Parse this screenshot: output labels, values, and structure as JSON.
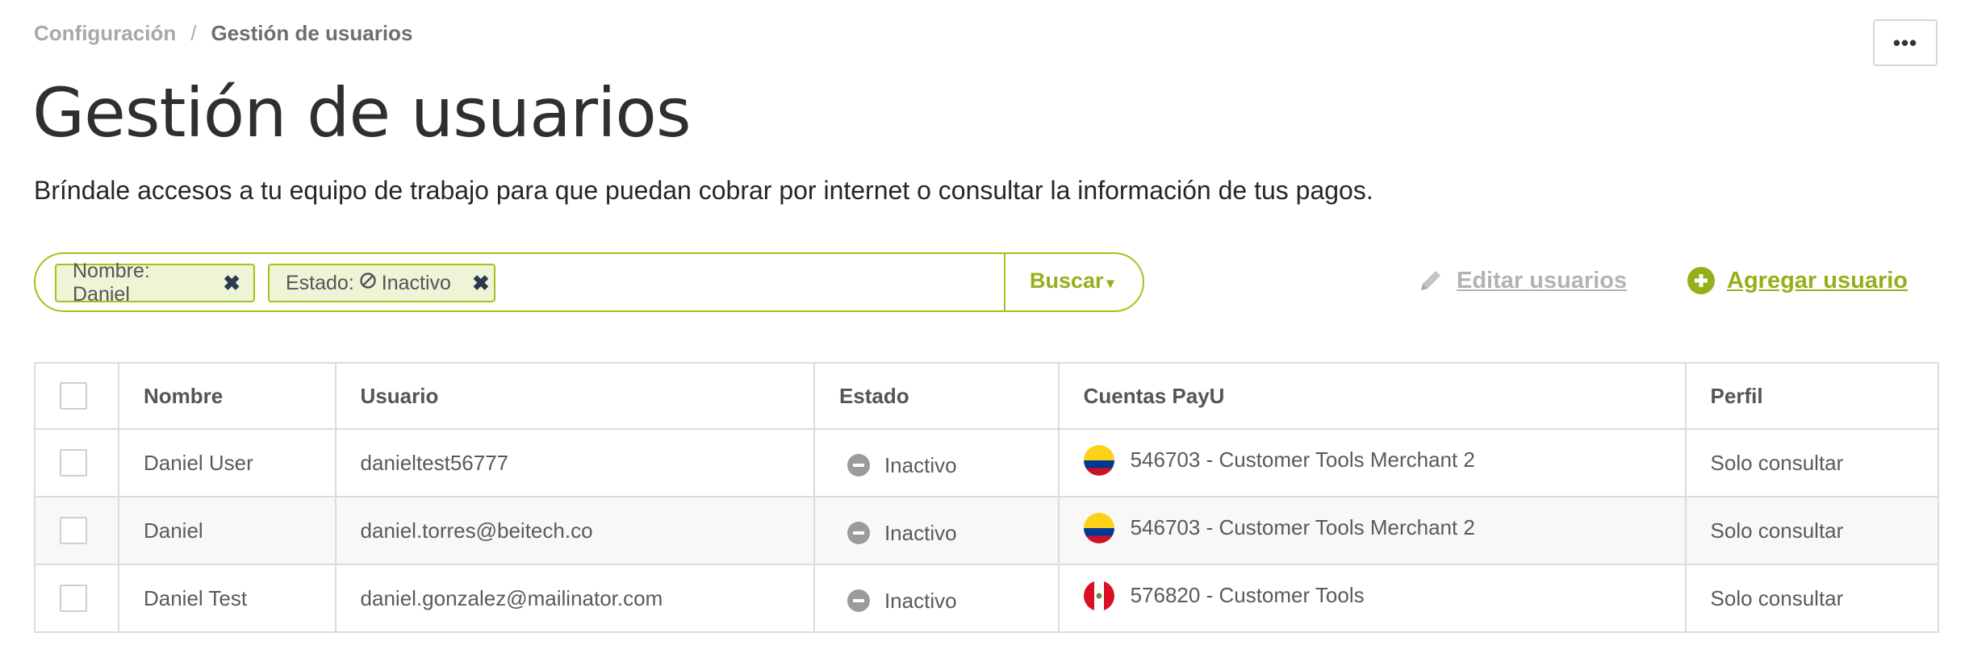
{
  "breadcrumb": {
    "parent": "Configuración",
    "separator": "/",
    "current": "Gestión de usuarios"
  },
  "header": {
    "more_label": "•••",
    "title": "Gestión de usuarios",
    "subtitle": "Bríndale accesos a tu equipo de trabajo para que puedan cobrar por internet o consultar la información de tus pagos."
  },
  "search": {
    "chips": [
      {
        "label": "Nombre: Daniel",
        "remove": "✖"
      },
      {
        "label_prefix": "Estado:",
        "label_value": "Inactivo",
        "remove": "✖"
      }
    ],
    "button_label": "Buscar",
    "caret": "▾"
  },
  "actions": {
    "edit_label": "Editar usuarios",
    "add_label": "Agregar usuario"
  },
  "table": {
    "columns": [
      "Nombre",
      "Usuario",
      "Estado",
      "Cuentas PayU",
      "Perfil"
    ],
    "rows": [
      {
        "name": "Daniel User",
        "user": "danieltest56777",
        "status": "Inactivo",
        "account": "546703 - Customer Tools Merchant 2",
        "flag": "colombia-flag-icon",
        "profile": "Solo consultar"
      },
      {
        "name": "Daniel",
        "user": "daniel.torres@beitech.co",
        "status": "Inactivo",
        "account": "546703 - Customer Tools Merchant 2",
        "flag": "colombia-flag-icon",
        "profile": "Solo consultar"
      },
      {
        "name": "Daniel Test",
        "user": "daniel.gonzalez@mailinator.com",
        "status": "Inactivo",
        "account": "576820 - Customer Tools",
        "flag": "peru-flag-icon",
        "profile": "Solo consultar"
      }
    ]
  },
  "colors": {
    "accent": "#a3c21b",
    "accent_text": "#93b01a",
    "chip_bg": "#eef4d6",
    "muted": "#b3b3b3",
    "colombia_yellow": "#fcd116",
    "colombia_blue": "#003893",
    "colombia_red": "#ce1126",
    "peru_red": "#d91023"
  }
}
